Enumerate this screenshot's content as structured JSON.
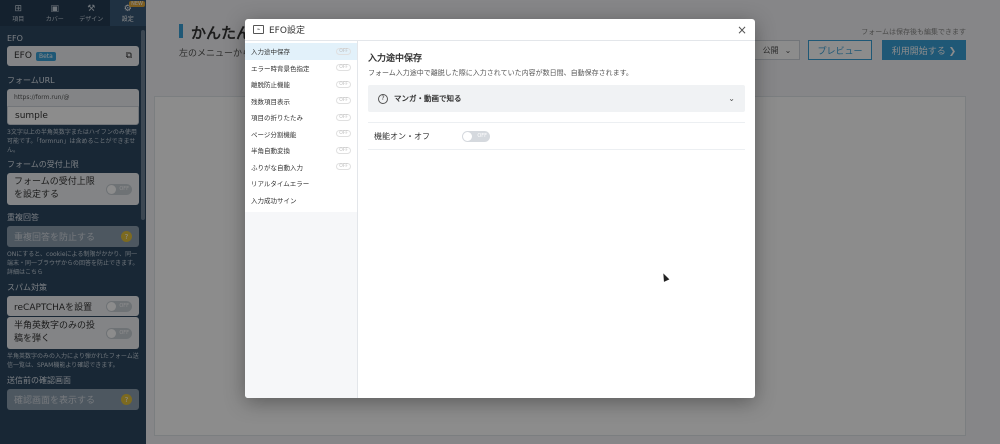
{
  "sidebar": {
    "nav": [
      {
        "icon": "plus-icon",
        "label": "項目"
      },
      {
        "icon": "image-icon",
        "label": "カバー"
      },
      {
        "icon": "wrench-icon",
        "label": "デザイン"
      },
      {
        "icon": "gear-icon",
        "label": "設定",
        "badge": "NEW"
      }
    ],
    "efo_label": "EFO",
    "efo_value": "EFO",
    "efo_beta": "Beta",
    "form_url_label": "フォームURL",
    "form_url_prefix": "https://form.run/@",
    "form_url_value": "sumple",
    "form_url_note": "3文字以上の半角英数字またはハイフンのみ使用可能です。「formrun」は含めることができません。",
    "limit_label": "フォームの受付上限",
    "limit_setting": "フォームの受付上限を設定する",
    "dup_label": "重複回答",
    "dup_setting": "重複回答を防止する",
    "dup_note": "ONにすると、cookieによる制限がかかり、同一端末・同一ブラウザからの回答を防止できます。詳細はこちら",
    "spam_label": "スパム対策",
    "recaptcha": "reCAPTCHAを設置",
    "halfwidth": "半角英数字のみの投稿を弾く",
    "halfwidth_note": "半角英数字のみの入力により弾かれたフォーム送信一覧は、SPAM機能より確認できます。",
    "confirm_label": "送信前の確認画面",
    "confirm_setting": "確認画面を表示する",
    "toggle_off": "OFF"
  },
  "main": {
    "title": "かんたん",
    "subtitle": "左のメニューから",
    "save_note": "フォームは保存後も編集できます",
    "publish": "公開",
    "preview": "プレビュー",
    "start": "利用開始する ❯"
  },
  "modal": {
    "title": "EFO設定",
    "close": "×",
    "menu": [
      {
        "label": "入力途中保存",
        "state": "OFF"
      },
      {
        "label": "エラー時背景色指定",
        "state": "OFF"
      },
      {
        "label": "離脱防止機能",
        "state": "OFF"
      },
      {
        "label": "残数項目表示",
        "state": "OFF"
      },
      {
        "label": "項目の折りたたみ",
        "state": "OFF"
      },
      {
        "label": "ページ分割機能",
        "state": "OFF"
      },
      {
        "label": "半角自動変換",
        "state": "OFF"
      },
      {
        "label": "ふりがな自動入力",
        "state": "OFF"
      },
      {
        "label": "リアルタイムエラー",
        "state": ""
      },
      {
        "label": "入力成功サイン",
        "state": ""
      }
    ],
    "content_title": "入力途中保存",
    "content_desc": "フォーム入力途中で離脱した際に入力されていた内容が数日間、自動保存されます。",
    "manga_label": "マンガ・動画で知る",
    "setting_label": "機能オン・オフ",
    "setting_state": "OFF"
  }
}
